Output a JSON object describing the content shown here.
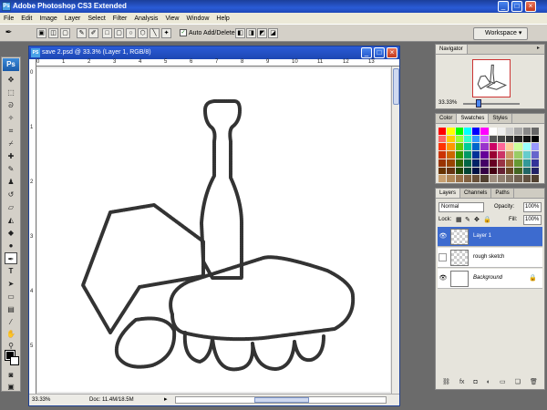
{
  "app": {
    "title": "Adobe Photoshop CS3 Extended",
    "icon_text": "Ps"
  },
  "window_buttons": {
    "minimize": "_",
    "maximize": "□",
    "close": "×"
  },
  "menu": [
    "File",
    "Edit",
    "Image",
    "Layer",
    "Select",
    "Filter",
    "Analysis",
    "View",
    "Window",
    "Help"
  ],
  "options": {
    "auto_add_label": "Auto Add/Delete",
    "auto_add_checked": true,
    "workspace_label": "Workspace ▾"
  },
  "document": {
    "title": "save 2.psd @ 33.3% (Layer 1, RGB/8)",
    "icon_text": "PS",
    "zoom": "33.33%",
    "doc_size": "Doc: 11.4M/18.5M",
    "ruler_top": [
      "0",
      "1",
      "2",
      "3",
      "4",
      "5",
      "6",
      "7",
      "8",
      "9",
      "10",
      "11",
      "12",
      "13"
    ],
    "ruler_left": [
      "0",
      "1",
      "2",
      "3",
      "4",
      "5"
    ]
  },
  "navigator": {
    "tab": "Navigator",
    "zoom": "33.33%"
  },
  "color_panel": {
    "tabs": [
      "Color",
      "Swatches",
      "Styles"
    ],
    "active_tab": "Swatches",
    "swatches": [
      "#ff0000",
      "#ffff00",
      "#00ff00",
      "#00ffff",
      "#0000ff",
      "#ff00ff",
      "#ffffff",
      "#eeeeee",
      "#cccccc",
      "#aaaaaa",
      "#888888",
      "#666666",
      "#ff6666",
      "#ffcc00",
      "#99ff33",
      "#33ffcc",
      "#3399ff",
      "#cc66ff",
      "#555555",
      "#444444",
      "#333333",
      "#222222",
      "#111111",
      "#000000",
      "#ff3300",
      "#ff9900",
      "#66cc00",
      "#00cc99",
      "#0066cc",
      "#9933cc",
      "#cc0066",
      "#ff6699",
      "#ffcc99",
      "#ccff99",
      "#99ffff",
      "#9999ff",
      "#cc3300",
      "#cc6600",
      "#339900",
      "#009966",
      "#003399",
      "#660099",
      "#990033",
      "#cc3366",
      "#cc9966",
      "#99cc66",
      "#66cccc",
      "#6666cc",
      "#993300",
      "#994400",
      "#336600",
      "#006644",
      "#002266",
      "#440066",
      "#660022",
      "#993344",
      "#996633",
      "#669933",
      "#339999",
      "#333399",
      "#663300",
      "#663311",
      "#224400",
      "#004433",
      "#001144",
      "#330044",
      "#440011",
      "#662233",
      "#664422",
      "#446622",
      "#226666",
      "#222266",
      "#c8a070",
      "#b08858",
      "#987048",
      "#806040",
      "#685038",
      "#504030",
      "#a09080",
      "#908070",
      "#807060",
      "#706050",
      "#605040",
      "#504030"
    ]
  },
  "layers_panel": {
    "tabs": [
      "Layers",
      "Channels",
      "Paths"
    ],
    "active_tab": "Layers",
    "blend_mode": "Normal",
    "opacity_label": "Opacity:",
    "opacity": "100%",
    "lock_label": "Lock:",
    "fill_label": "Fill:",
    "fill": "100%",
    "layers": [
      {
        "name": "Layer 1",
        "visible": true,
        "selected": true
      },
      {
        "name": "rough sketch",
        "visible": false,
        "selected": false
      },
      {
        "name": "Background",
        "visible": true,
        "selected": false,
        "locked": true
      }
    ],
    "footer_icons": [
      "link-icon",
      "fx-icon",
      "mask-icon",
      "adjustment-icon",
      "group-icon",
      "new-layer-icon",
      "trash-icon"
    ],
    "footer_glyphs": [
      "⛓",
      "fx",
      "◘",
      "◐",
      "▭",
      "❏",
      "🗑"
    ]
  }
}
